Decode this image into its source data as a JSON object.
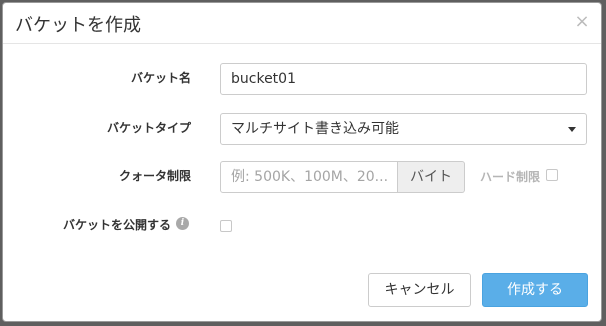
{
  "dialog": {
    "title": "バケットを作成",
    "close_glyph": "×"
  },
  "form": {
    "bucket_name": {
      "label": "バケット名",
      "value": "bucket01"
    },
    "bucket_type": {
      "label": "バケットタイプ",
      "selected": "マルチサイト書き込み可能"
    },
    "quota": {
      "label": "クォータ制限",
      "placeholder": "例: 500K、100M、20...",
      "unit": "バイト",
      "hard_limit_label": "ハード制限"
    },
    "publish": {
      "label": "バケットを公開する",
      "info_glyph": "i"
    }
  },
  "footer": {
    "cancel_label": "キャンセル",
    "create_label": "作成する"
  },
  "colors": {
    "primary": "#5aaee8",
    "backdrop": "#5f5f5f"
  }
}
